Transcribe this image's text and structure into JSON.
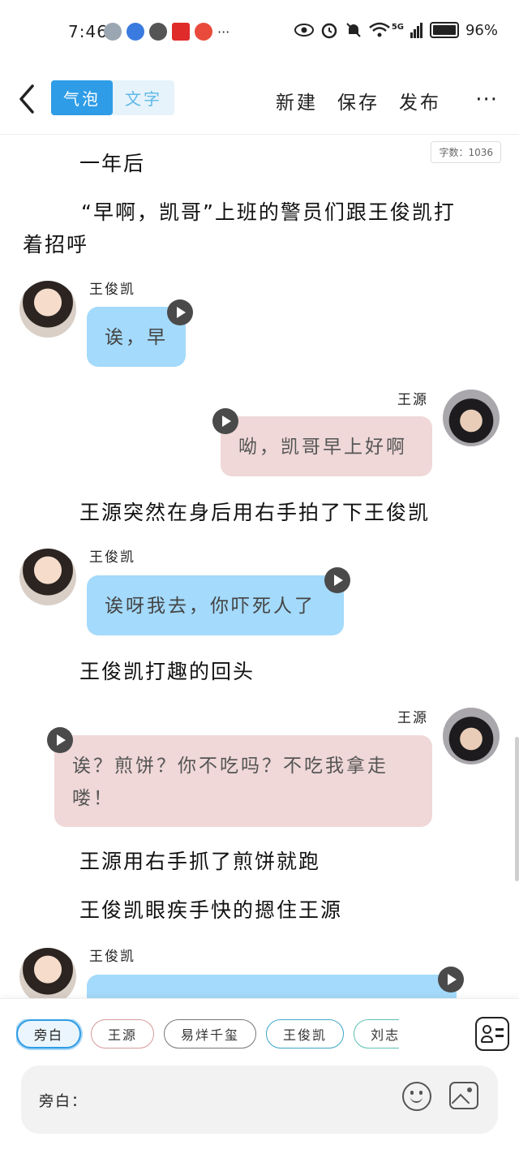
{
  "status_bar": {
    "time": "7:46",
    "battery": "96%",
    "network": "5G",
    "more_apps": "···"
  },
  "nav": {
    "mode_bubble": "气泡",
    "mode_text": "文字",
    "new_label": "新建",
    "save_label": "保存",
    "publish_label": "发布",
    "more_label": "···"
  },
  "word_count": "字数：1036",
  "story": {
    "line1": "一年后",
    "line2": "“早啊，凯哥”上班的警员们跟王俊凯打",
    "line2b": "着招呼",
    "msg1": {
      "speaker": "王俊凯",
      "text": "诶，早"
    },
    "msg2": {
      "speaker": "王源",
      "text": "呦，凯哥早上好啊"
    },
    "line3": "王源突然在身后用右手拍了下王俊凯",
    "msg3": {
      "speaker": "王俊凯",
      "text": "诶呀我去，你吓死人了"
    },
    "line4": "王俊凯打趣的回头",
    "msg4": {
      "speaker": "王源",
      "text": "诶？煎饼？你不吃吗？不吃我拿走",
      "text2": "喽！"
    },
    "line5": "王源用右手抓了煎饼就跑",
    "line6": "王俊凯眼疾手快的摁住王源",
    "msg5": {
      "speaker": "王俊凯"
    }
  },
  "roles": [
    "旁白",
    "王源",
    "易烊千玺",
    "王俊凯",
    "刘志"
  ],
  "input": {
    "label": "旁白："
  }
}
